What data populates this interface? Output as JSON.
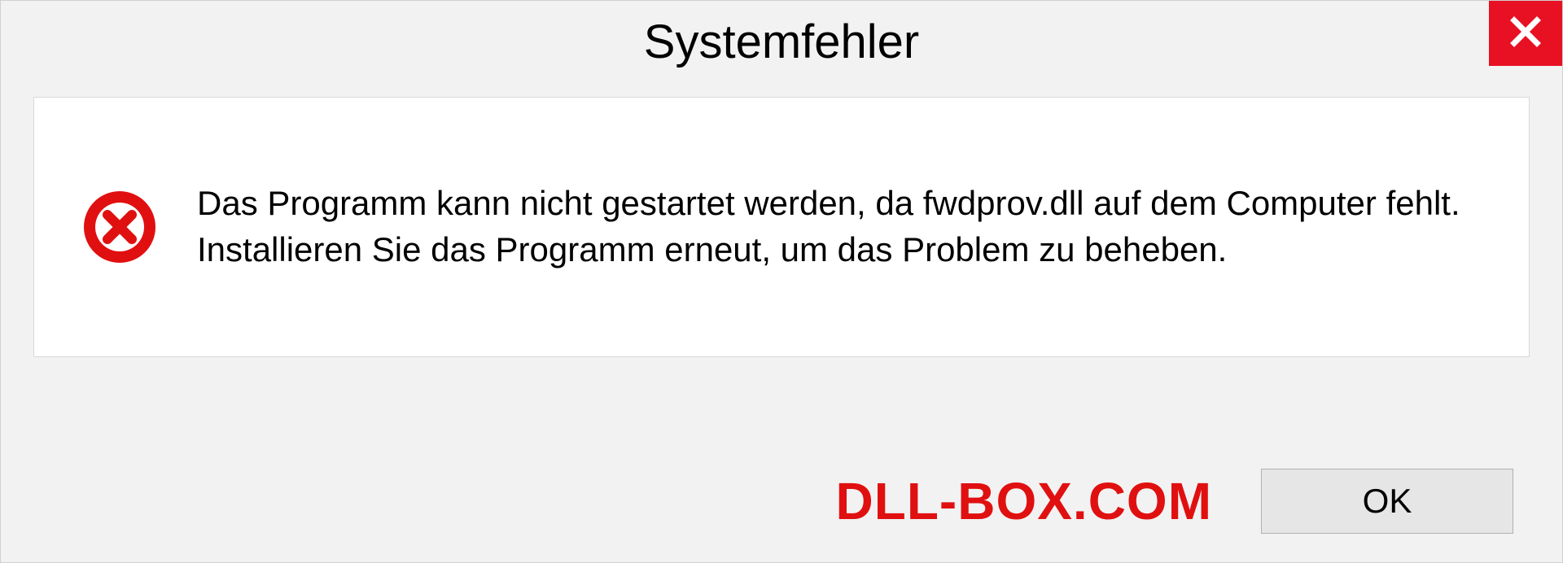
{
  "dialog": {
    "title": "Systemfehler",
    "message": "Das Programm kann nicht gestartet werden, da fwdprov.dll auf dem Computer fehlt. Installieren Sie das Programm erneut, um das Problem zu beheben.",
    "ok_label": "OK"
  },
  "watermark": "DLL-BOX.COM"
}
